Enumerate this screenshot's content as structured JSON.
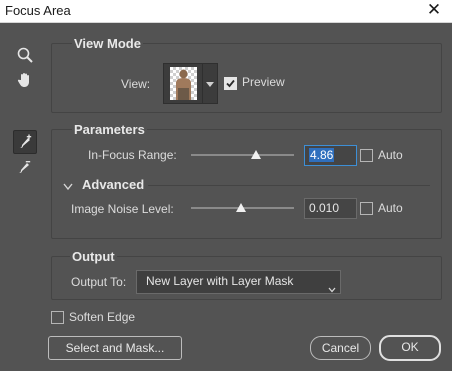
{
  "window": {
    "title": "Focus Area"
  },
  "tools": [
    {
      "name": "zoom",
      "icon": "zoom-icon"
    },
    {
      "name": "hand",
      "icon": "hand-icon"
    },
    {
      "name": "focus-area-add",
      "icon": "focus-add-brush-icon"
    },
    {
      "name": "focus-area-subtract",
      "icon": "focus-subtract-brush-icon"
    }
  ],
  "view_mode": {
    "heading": "View Mode",
    "view_label": "View:",
    "preview_label": "Preview",
    "preview_checked": true
  },
  "parameters": {
    "heading": "Parameters",
    "in_focus_label": "In-Focus Range:",
    "in_focus_value": "4.86",
    "in_focus_auto_label": "Auto",
    "advanced_heading": "Advanced",
    "noise_label": "Image Noise Level:",
    "noise_value": "0.010",
    "noise_auto_label": "Auto"
  },
  "output": {
    "heading": "Output",
    "output_to_label": "Output To:",
    "output_to_value": "New Layer with Layer Mask"
  },
  "soften_edge_label": "Soften Edge",
  "buttons": {
    "select_and_mask": "Select and Mask...",
    "cancel": "Cancel",
    "ok": "OK"
  },
  "colors": {
    "background": "#535353",
    "focus_blue": "#3d8fd6"
  }
}
